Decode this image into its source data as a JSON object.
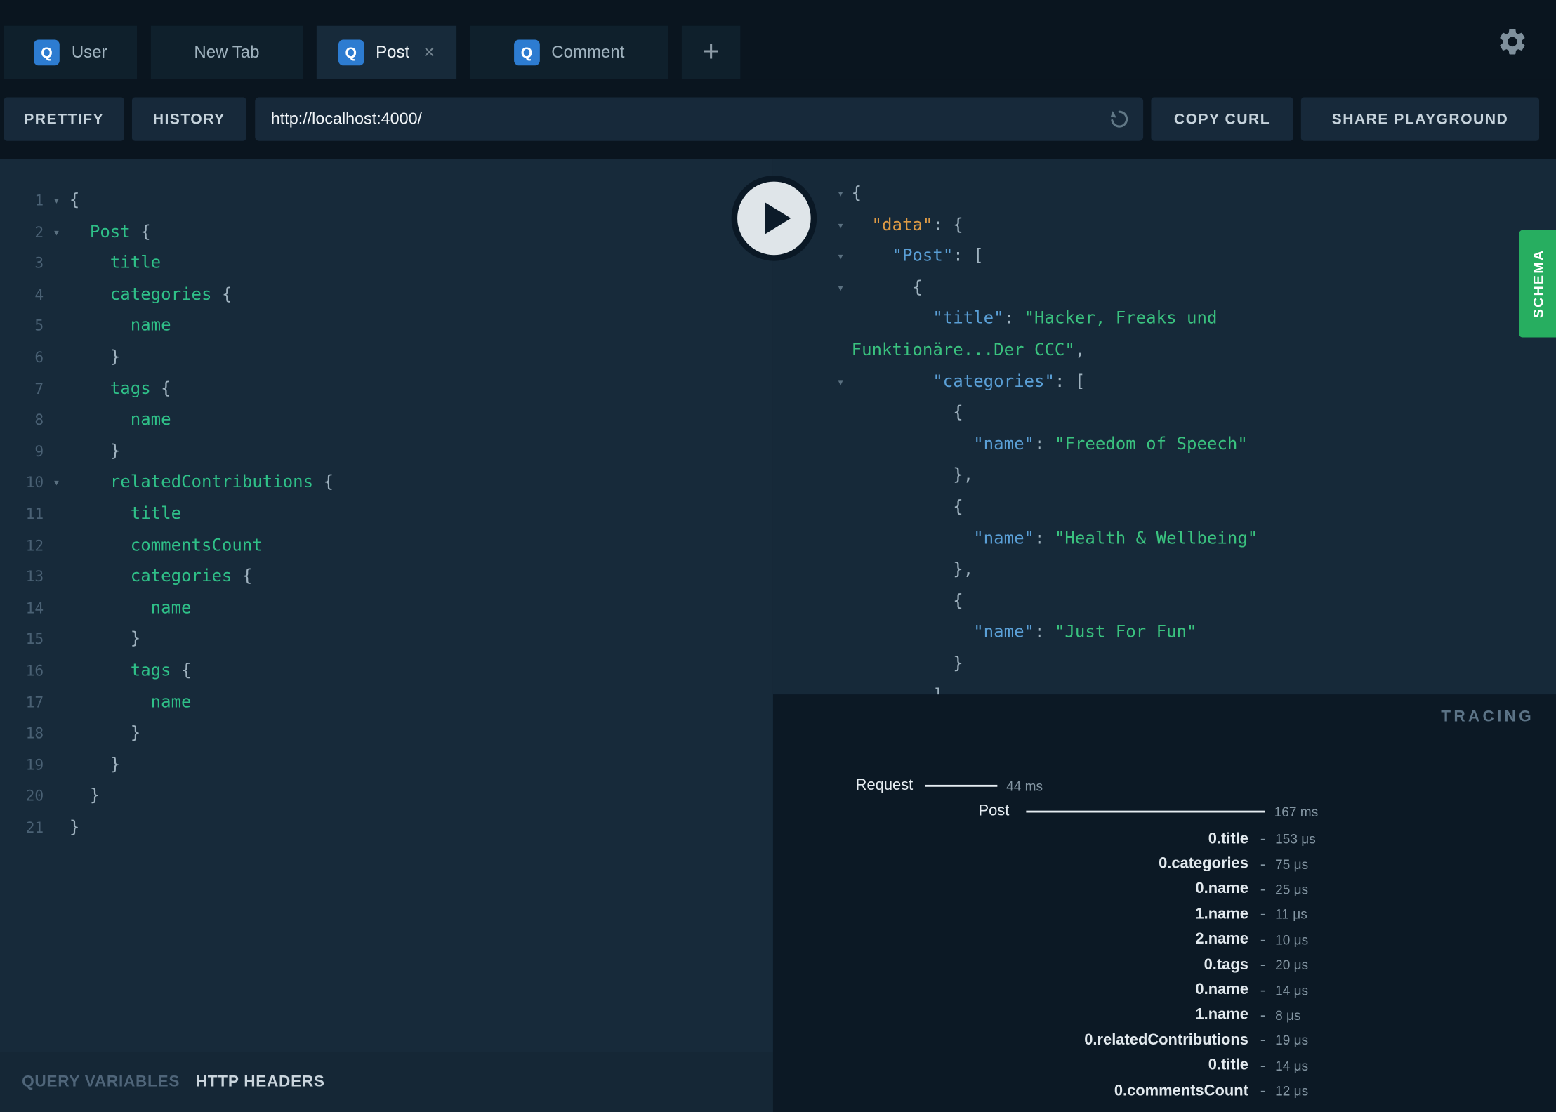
{
  "window": {
    "tabs": [
      {
        "icon": "Q",
        "label": "User"
      },
      {
        "label": "New Tab"
      },
      {
        "icon": "Q",
        "label": "Post",
        "close": "×",
        "active": true
      },
      {
        "icon": "Q",
        "label": "Comment"
      }
    ],
    "new_tab_button": "+",
    "settings_icon": "gear-icon"
  },
  "toolbar": {
    "prettify_label": "PRETTIFY",
    "history_label": "HISTORY",
    "url_value": "http://localhost:4000/",
    "reset_icon": "circular-arrow-icon",
    "copy_curl_label": "COPY CURL",
    "share_label": "SHARE PLAYGROUND"
  },
  "colors": {
    "accent_blue": "#2d7cd1",
    "schema_green": "#27ae60",
    "field_green": "#2fc088",
    "key_blue": "#5a9fd6",
    "root_key_orange": "#dd9a45",
    "string_green": "#3ac27f"
  },
  "query_editor": {
    "lines": [
      {
        "num": 1,
        "fold": true,
        "segments": [
          [
            "p",
            "{"
          ]
        ]
      },
      {
        "num": 2,
        "fold": true,
        "segments": [
          [
            "p",
            "  "
          ],
          [
            "f",
            "Post"
          ],
          [
            "p",
            " {"
          ]
        ]
      },
      {
        "num": 3,
        "segments": [
          [
            "p",
            "    "
          ],
          [
            "f",
            "title"
          ]
        ]
      },
      {
        "num": 4,
        "segments": [
          [
            "p",
            "    "
          ],
          [
            "f",
            "categories"
          ],
          [
            "p",
            " {"
          ]
        ]
      },
      {
        "num": 5,
        "segments": [
          [
            "p",
            "      "
          ],
          [
            "f",
            "name"
          ]
        ]
      },
      {
        "num": 6,
        "segments": [
          [
            "p",
            "    }"
          ]
        ]
      },
      {
        "num": 7,
        "segments": [
          [
            "p",
            "    "
          ],
          [
            "f",
            "tags"
          ],
          [
            "p",
            " {"
          ]
        ]
      },
      {
        "num": 8,
        "segments": [
          [
            "p",
            "      "
          ],
          [
            "f",
            "name"
          ]
        ]
      },
      {
        "num": 9,
        "segments": [
          [
            "p",
            "    }"
          ]
        ]
      },
      {
        "num": 10,
        "fold": true,
        "segments": [
          [
            "p",
            "    "
          ],
          [
            "f",
            "relatedContributions"
          ],
          [
            "p",
            " {"
          ]
        ]
      },
      {
        "num": 11,
        "segments": [
          [
            "p",
            "      "
          ],
          [
            "f",
            "title"
          ]
        ]
      },
      {
        "num": 12,
        "segments": [
          [
            "p",
            "      "
          ],
          [
            "f",
            "commentsCount"
          ]
        ]
      },
      {
        "num": 13,
        "segments": [
          [
            "p",
            "      "
          ],
          [
            "f",
            "categories"
          ],
          [
            "p",
            " {"
          ]
        ]
      },
      {
        "num": 14,
        "segments": [
          [
            "p",
            "        "
          ],
          [
            "f",
            "name"
          ]
        ]
      },
      {
        "num": 15,
        "segments": [
          [
            "p",
            "      }"
          ]
        ]
      },
      {
        "num": 16,
        "segments": [
          [
            "p",
            "      "
          ],
          [
            "f",
            "tags"
          ],
          [
            "p",
            " {"
          ]
        ]
      },
      {
        "num": 17,
        "segments": [
          [
            "p",
            "        "
          ],
          [
            "f",
            "name"
          ]
        ]
      },
      {
        "num": 18,
        "segments": [
          [
            "p",
            "      }"
          ]
        ]
      },
      {
        "num": 19,
        "segments": [
          [
            "p",
            "    }"
          ]
        ]
      },
      {
        "num": 20,
        "segments": [
          [
            "p",
            "  }"
          ]
        ]
      },
      {
        "num": 21,
        "segments": [
          [
            "p",
            "}"
          ]
        ]
      }
    ]
  },
  "response_viewer": {
    "lines": [
      {
        "fold": true,
        "segments": [
          [
            "p",
            "{"
          ]
        ]
      },
      {
        "fold": true,
        "segments": [
          [
            "p",
            "  "
          ],
          [
            "ko",
            "\"data\""
          ],
          [
            "p",
            ": {"
          ]
        ]
      },
      {
        "fold": true,
        "segments": [
          [
            "p",
            "    "
          ],
          [
            "k",
            "\"Post\""
          ],
          [
            "p",
            ": ["
          ]
        ]
      },
      {
        "fold": true,
        "segments": [
          [
            "p",
            "      {"
          ]
        ]
      },
      {
        "segments": [
          [
            "p",
            "        "
          ],
          [
            "k",
            "\"title\""
          ],
          [
            "p",
            ": "
          ],
          [
            "s",
            "\"Hacker, Freaks und"
          ]
        ]
      },
      {
        "segments": [
          [
            "s",
            "Funktionäre...Der CCC\""
          ],
          [
            "p",
            ","
          ]
        ]
      },
      {
        "fold": true,
        "segments": [
          [
            "p",
            "        "
          ],
          [
            "k",
            "\"categories\""
          ],
          [
            "p",
            ": ["
          ]
        ]
      },
      {
        "segments": [
          [
            "p",
            "          {"
          ]
        ]
      },
      {
        "segments": [
          [
            "p",
            "            "
          ],
          [
            "k",
            "\"name\""
          ],
          [
            "p",
            ": "
          ],
          [
            "s",
            "\"Freedom of Speech\""
          ]
        ]
      },
      {
        "segments": [
          [
            "p",
            "          },"
          ]
        ]
      },
      {
        "segments": [
          [
            "p",
            "          {"
          ]
        ]
      },
      {
        "segments": [
          [
            "p",
            "            "
          ],
          [
            "k",
            "\"name\""
          ],
          [
            "p",
            ": "
          ],
          [
            "s",
            "\"Health & Wellbeing\""
          ]
        ]
      },
      {
        "segments": [
          [
            "p",
            "          },"
          ]
        ]
      },
      {
        "segments": [
          [
            "p",
            "          {"
          ]
        ]
      },
      {
        "segments": [
          [
            "p",
            "            "
          ],
          [
            "k",
            "\"name\""
          ],
          [
            "p",
            ": "
          ],
          [
            "s",
            "\"Just For Fun\""
          ]
        ]
      },
      {
        "segments": [
          [
            "p",
            "          }"
          ]
        ]
      },
      {
        "segments": [
          [
            "p",
            "        ]"
          ]
        ]
      }
    ]
  },
  "schema_tab": {
    "label": "SCHEMA"
  },
  "tracing": {
    "title": "TRACING",
    "request": {
      "label": "Request",
      "time": "44 ms"
    },
    "root_field": {
      "label": "Post",
      "time": "167 ms"
    },
    "resolvers": [
      {
        "label": "0.title",
        "time": "153 μs"
      },
      {
        "label": "0.categories",
        "time": "75 μs"
      },
      {
        "label": "0.name",
        "time": "25 μs"
      },
      {
        "label": "1.name",
        "time": "11 μs"
      },
      {
        "label": "2.name",
        "time": "10 μs"
      },
      {
        "label": "0.tags",
        "time": "20 μs"
      },
      {
        "label": "0.name",
        "time": "14 μs"
      },
      {
        "label": "1.name",
        "time": "8 μs"
      },
      {
        "label": "0.relatedContributions",
        "time": "19 μs"
      },
      {
        "label": "0.title",
        "time": "14 μs"
      },
      {
        "label": "0.commentsCount",
        "time": "12 μs"
      }
    ]
  },
  "bottom_bar": {
    "query_variables_label": "QUERY VARIABLES",
    "http_headers_label": "HTTP HEADERS"
  }
}
